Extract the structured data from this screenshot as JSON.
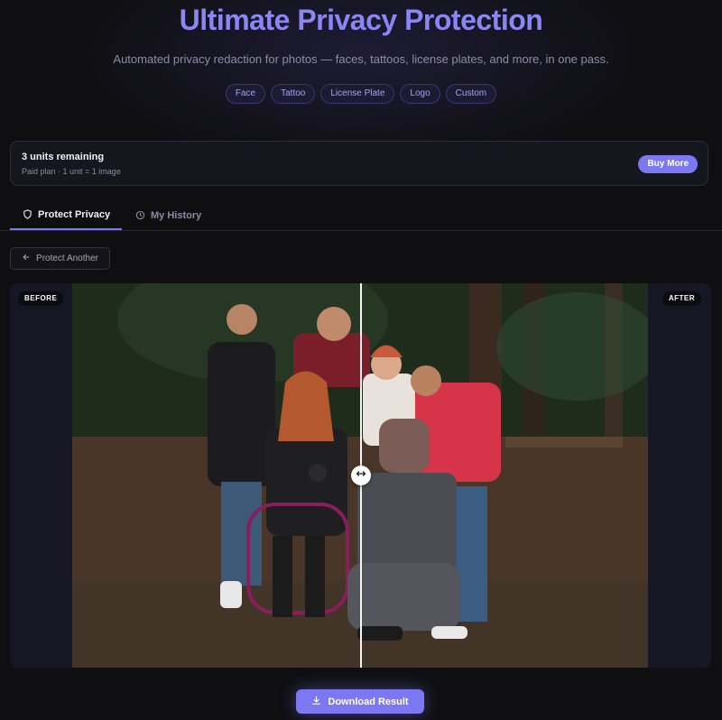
{
  "header": {
    "title": "Ultimate Privacy Protection",
    "subtitle": "Automated privacy redaction for photos — faces, tattoos, license plates, and more, in one pass.",
    "chips": [
      "Face",
      "Tattoo",
      "License Plate",
      "Logo",
      "Custom"
    ]
  },
  "units": {
    "title": "3 units remaining",
    "subtitle": "Paid plan · 1 unit = 1 image",
    "buy_label": "Buy More"
  },
  "tabs": [
    {
      "label": "Protect Privacy",
      "icon": "shield-icon",
      "active": true
    },
    {
      "label": "My History",
      "icon": "clock-icon",
      "active": false
    }
  ],
  "back_button": {
    "label": "Protect Another",
    "icon": "arrow-left-icon"
  },
  "comparison": {
    "before_label": "BEFORE",
    "after_label": "AFTER",
    "handle_icon": "double-arrow-icon"
  },
  "download": {
    "label": "Download Result",
    "icon": "download-icon"
  },
  "colors": {
    "accent": "#7c78f2",
    "title": "#8b86f5",
    "background": "#0f0f12"
  }
}
